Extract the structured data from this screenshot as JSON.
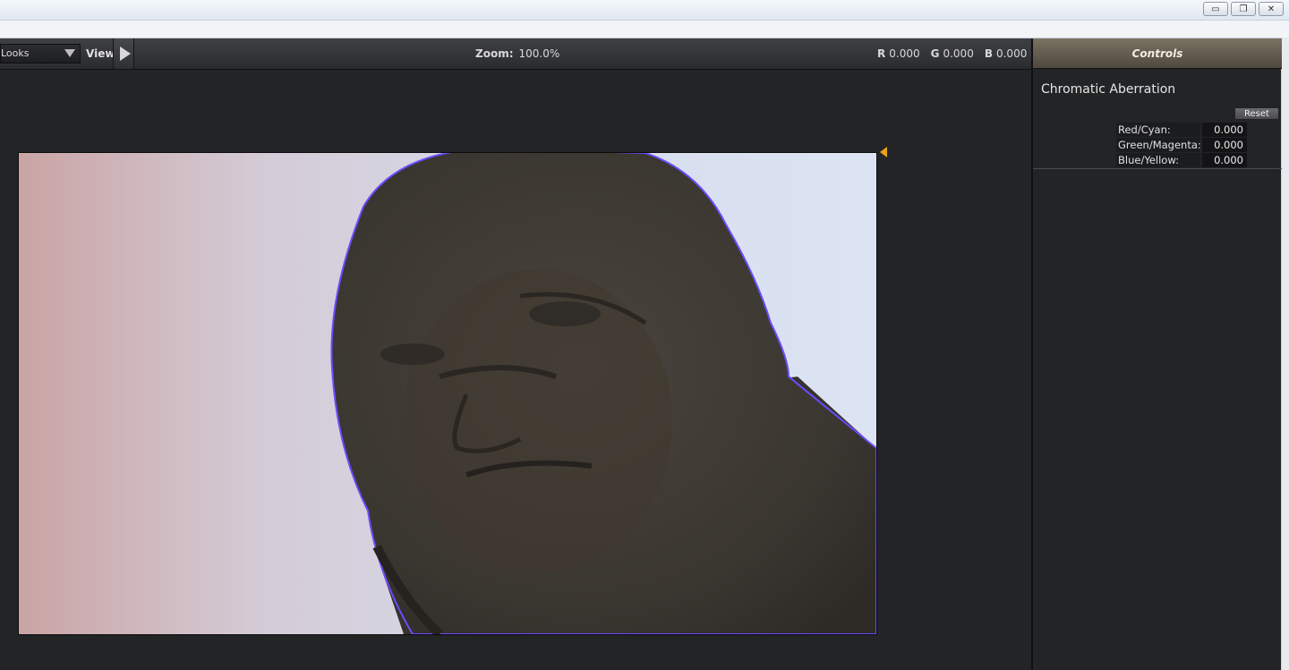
{
  "window": {
    "buttons": [
      {
        "name": "minimize-button",
        "glyph": "▭"
      },
      {
        "name": "restore-button",
        "glyph": "❐"
      },
      {
        "name": "close-button",
        "glyph": "✕"
      }
    ]
  },
  "toolbar": {
    "looks_label": "Looks",
    "view_label": "View",
    "zoom_label": "Zoom:",
    "zoom_value": "100.0%",
    "r_label": "R",
    "r_value": "0.000",
    "g_label": "G",
    "g_value": "0.000",
    "b_label": "B",
    "b_value": "0.000"
  },
  "controls": {
    "header": "Controls",
    "section_title": "Chromatic Aberration",
    "reset_label": "Reset",
    "params": [
      {
        "label": "Red/Cyan:",
        "value": "0.000"
      },
      {
        "label": "Green/Magenta:",
        "value": "0.000"
      },
      {
        "label": "Blue/Yellow:",
        "value": "0.000"
      }
    ]
  },
  "colors": {
    "accent_marker": "#e8a21c",
    "panel_bg": "#232426",
    "controls_header": "#6a6354"
  }
}
